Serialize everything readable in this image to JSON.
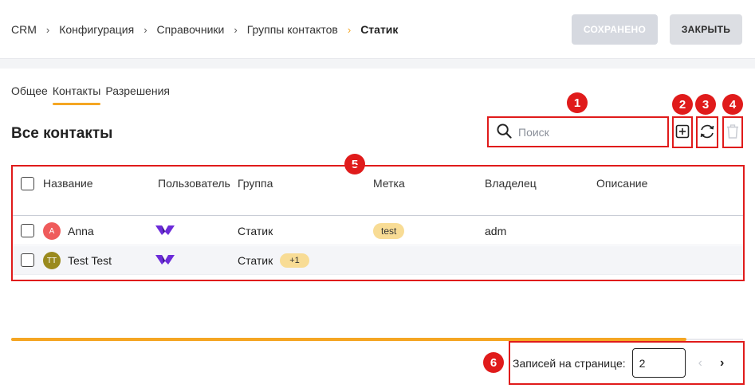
{
  "breadcrumb": {
    "items": [
      "CRM",
      "Конфигурация",
      "Справочники",
      "Группы контактов"
    ],
    "current": "Статик",
    "separator": "›"
  },
  "header": {
    "saved_label": "СОХРАНЕНО",
    "close_label": "ЗАКРЫТЬ"
  },
  "tabs": [
    {
      "label": "Общее",
      "active": false
    },
    {
      "label": "Контакты",
      "active": true
    },
    {
      "label": "Разрешения",
      "active": false
    }
  ],
  "section": {
    "title": "Все контакты"
  },
  "search": {
    "placeholder": "Поиск",
    "icon": "search-icon"
  },
  "toolbar": {
    "add_icon": "add-icon",
    "refresh_icon": "refresh-icon",
    "delete_icon": "delete-icon"
  },
  "annotations": [
    "1",
    "2",
    "3",
    "4",
    "5",
    "6"
  ],
  "table": {
    "columns": [
      "Название",
      "Пользователь",
      "Группа",
      "Метка",
      "Владелец",
      "Описание"
    ],
    "rows": [
      {
        "initials": "A",
        "avatar_color": "#ef5b5b",
        "name": "Anna",
        "user_icon": "user-logo-icon",
        "group": "Статик",
        "group_more": "",
        "tag": "test",
        "owner": "adm",
        "description": ""
      },
      {
        "initials": "TT",
        "avatar_color": "#9a8a1e",
        "name": "Test Test",
        "user_icon": "user-logo-icon",
        "group": "Статик",
        "group_more": "+1",
        "tag": "",
        "owner": "",
        "description": ""
      }
    ]
  },
  "pagination": {
    "label": "Записей на странице:",
    "value": "2",
    "prev": "‹",
    "next": "›"
  },
  "colors": {
    "accent": "#f5a623",
    "highlight": "#e01b1b",
    "tag_bg": "#f8dc95"
  }
}
